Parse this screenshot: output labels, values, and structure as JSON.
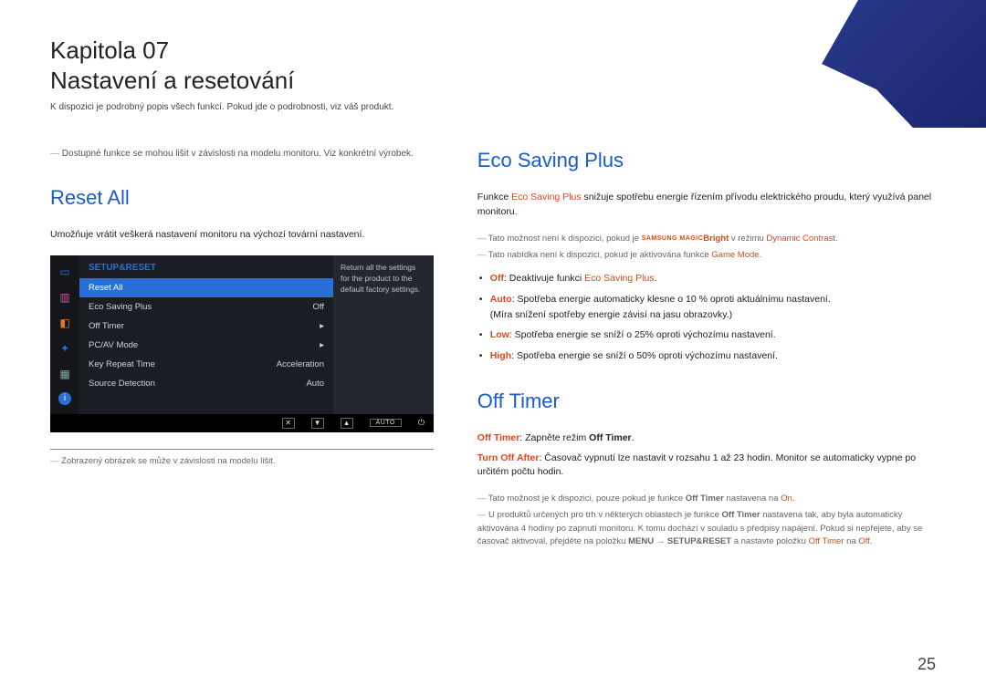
{
  "chapter": {
    "label": "Kapitola 07",
    "title": "Nastavení a resetování",
    "subtitle": "K dispozici je podrobný popis všech funkcí. Pokud jde o podrobnosti, viz váš produkt."
  },
  "left": {
    "note_top": "Dostupné funkce se mohou lišit v závislosti na modelu monitoru. Viz konkrétní výrobek.",
    "heading": "Reset All",
    "desc": "Umožňuje vrátit veškerá nastavení monitoru na výchozí tovární nastavení.",
    "osd": {
      "header": "SETUP&RESET",
      "rows": [
        {
          "label": "Reset All",
          "value": "",
          "selected": true
        },
        {
          "label": "Eco Saving Plus",
          "value": "Off"
        },
        {
          "label": "Off Timer",
          "value": "▸"
        },
        {
          "label": "PC/AV Mode",
          "value": "▸"
        },
        {
          "label": "Key Repeat Time",
          "value": "Acceleration"
        },
        {
          "label": "Source Detection",
          "value": "Auto"
        }
      ],
      "desc": "Return all the settings for the product to the default factory settings.",
      "footer_auto": "AUTO"
    },
    "note_bottom": "Zobrazený obrázek se může v závislosti na modelu lišit."
  },
  "right": {
    "eco": {
      "heading": "Eco Saving Plus",
      "intro_a": "Funkce ",
      "intro_b": "Eco Saving Plus",
      "intro_c": " snižuje spotřebu energie řízením přívodu elektrického proudu, který využívá panel monitoru.",
      "note1_a": "Tato možnost není k dispozici, pokud je ",
      "note1_magic": "SAMSUNG MAGIC",
      "note1_b": "Bright",
      "note1_c": " v režimu ",
      "note1_d": "Dynamic Contrast",
      "note1_e": ".",
      "note2_a": "Tato nabídka není k dispozici, pokud je aktivována funkce ",
      "note2_b": "Game Mode",
      "note2_c": ".",
      "bul_off_a": "Off",
      "bul_off_b": ": Deaktivuje funkci ",
      "bul_off_c": "Eco Saving Plus",
      "bul_off_d": ".",
      "bul_auto_a": "Auto",
      "bul_auto_b": ": Spotřeba energie automaticky klesne o 10 % oproti aktuálnímu nastavení.",
      "bul_auto_c": "(Míra snížení spotřeby energie závisí na jasu obrazovky.)",
      "bul_low_a": "Low",
      "bul_low_b": ": Spotřeba energie se sníží o 25% oproti výchozímu nastavení.",
      "bul_high_a": "High",
      "bul_high_b": ": Spotřeba energie se sníží o 50% oproti výchozímu nastavení."
    },
    "off": {
      "heading": "Off Timer",
      "p1_a": "Off Timer",
      "p1_b": ": Zapněte režim ",
      "p1_c": "Off Timer",
      "p1_d": ".",
      "p2_a": "Turn Off After",
      "p2_b": ": Časovač vypnutí lze nastavit v rozsahu 1 až 23 hodin. Monitor se automaticky vypne po určitém počtu hodin.",
      "n1_a": "Tato možnost je k dispozici, pouze pokud je funkce ",
      "n1_b": "Off Timer",
      "n1_c": " nastavena na ",
      "n1_d": "On",
      "n1_e": ".",
      "n2_a": "U produktů určených pro trh v některých oblastech je funkce ",
      "n2_b": "Off Timer",
      "n2_c": " nastavena tak, aby byla automaticky aktivována 4 hodiny po zapnutí monitoru. K tomu dochází v souladu s předpisy napájení. Pokud si nepřejete, aby se časovač aktivoval, přejděte na položku ",
      "n2_menu": "MENU",
      "n2_arrow": " → ",
      "n2_setup": "SETUP&RESET",
      "n2_d": " a nastavte položku ",
      "n2_e": "Off Timer",
      "n2_f": " na ",
      "n2_g": "Off",
      "n2_h": "."
    }
  },
  "page_number": "25"
}
